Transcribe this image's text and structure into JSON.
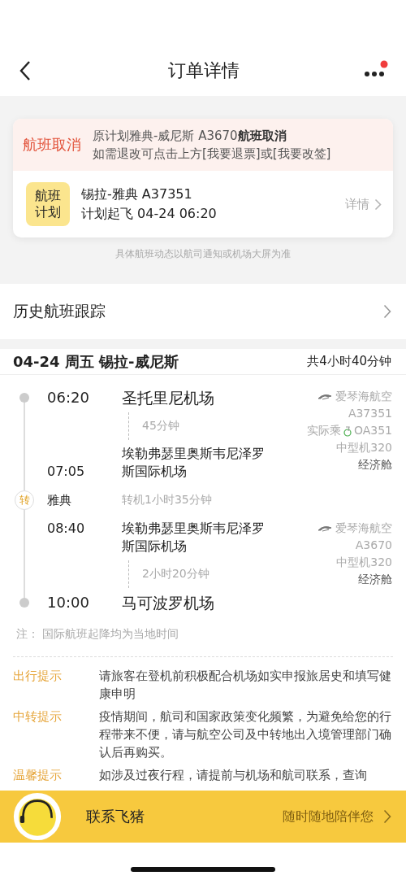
{
  "header": {
    "title": "订单详情",
    "has_notification": true
  },
  "alert": {
    "label": "航班取消",
    "lines": [
      "原计划雅典-威尼斯 A3670**航班取消**",
      "如需退改可点击上方[我要退票]或[我要改签]"
    ]
  },
  "plan": {
    "badge": "航班计划",
    "route": "锡拉-雅典 A37351",
    "departure": "计划起飞 04-24 06:20",
    "link": "详情"
  },
  "plan_note": "具体航班动态以航司通知或机场大屏为准",
  "history": {
    "label": "历史航班跟踪"
  },
  "trip": {
    "title": "04-24 周五 锡拉-威尼斯",
    "total": "共4小时40分钟",
    "legs": [
      {
        "departure": {
          "kind": "endpoint",
          "time": "06:20",
          "airport": "圣托里尼机场"
        },
        "duration": "45分钟",
        "arrival": {
          "kind": "stop",
          "time": "07:05",
          "airport": "埃勒弗瑟里奥斯韦尼泽罗斯国际机场"
        },
        "airline": "爱琴海航空",
        "flight_no": "A37351",
        "operated_by": {
          "label": "实际乘",
          "flight_no": "OA351"
        },
        "aircraft": "中型机320",
        "cabin": "经济舱"
      },
      {
        "departure": {
          "kind": "stop",
          "time": "08:40",
          "airport": "埃勒弗瑟里奥斯韦尼泽罗斯国际机场"
        },
        "duration": "2小时20分钟",
        "arrival": {
          "kind": "endpoint",
          "time": "10:00",
          "airport": "马可波罗机场"
        },
        "airline": "爱琴海航空",
        "flight_no": "A3670",
        "aircraft": "中型机320",
        "cabin": "经济舱"
      }
    ],
    "transfer": {
      "badge": "转",
      "city": "雅典",
      "duration": "转机1小时35分钟"
    },
    "note": "注：  国际航班起降均为当地时间"
  },
  "tips": [
    {
      "label": "出行提示",
      "text": "请旅客在登机前积极配合机场如实申报旅居史和填写健康申明"
    },
    {
      "label": "中转提示",
      "text": "疫情期间，航司和国家政策变化频繁，为避免给您的行程带来不便，请与航空公司及中转地出入境管理部门确认后再购买。"
    },
    {
      "label": "温馨提示",
      "text": "如涉及过夜行程，请提前与机场和航司联系，查询"
    }
  ],
  "contact": {
    "label": "联系飞猪",
    "slogan": "随时随地陪伴您"
  }
}
